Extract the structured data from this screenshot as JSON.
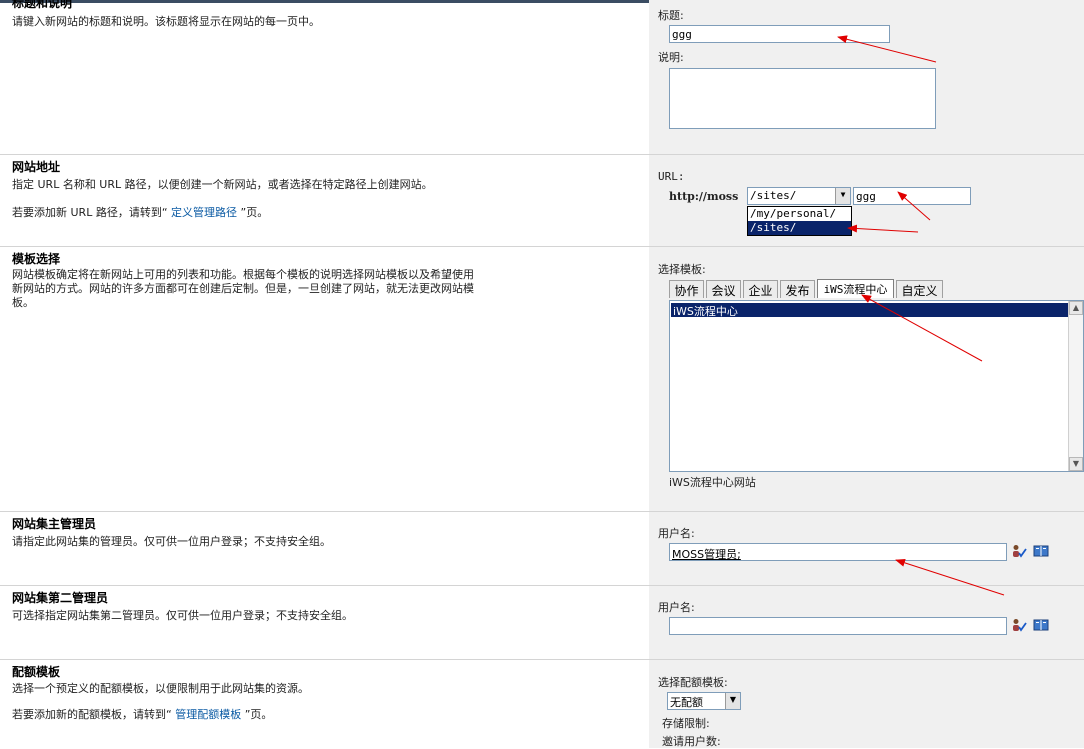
{
  "sections": {
    "title_desc": {
      "title": "标题和说明",
      "desc": "请键入新网站的标题和说明。该标题将显示在网站的每一页中。",
      "title_label": "标题:",
      "title_value": "ggg",
      "desc_label": "说明:",
      "desc_value": ""
    },
    "site_address": {
      "title": "网站地址",
      "desc": "指定 URL 名称和 URL 路径，以便创建一个新网站，或者选择在特定路径上创建网站。",
      "hint_prefix": "若要添加新 URL 路径，请转到“",
      "hint_link": "定义管理路径",
      "hint_suffix": "”页。",
      "url_label": "URL:",
      "url_prefix": "http://moss",
      "path_selected": "/sites/",
      "path_options": [
        "/my/personal/",
        "/sites/"
      ],
      "site_name": "ggg"
    },
    "template": {
      "title": "模板选择",
      "desc": "网站模板确定将在新网站上可用的列表和功能。根据每个模板的说明选择网站模板以及希望使用新网站的方式。网站的许多方面都可在创建后定制。但是，一旦创建了网站，就无法更改网站模板。",
      "select_label": "选择模板:",
      "tabs": [
        "协作",
        "会议",
        "企业",
        "发布",
        "iWS流程中心",
        "自定义"
      ],
      "list_item": "iWS流程中心",
      "item_desc": "iWS流程中心网站"
    },
    "primary_admin": {
      "title": "网站集主管理员",
      "desc": "请指定此网站集的管理员。仅可供一位用户登录；不支持安全组。",
      "user_label": "用户名:",
      "user_value": "MOSS管理员;"
    },
    "secondary_admin": {
      "title": "网站集第二管理员",
      "desc": "可选择指定网站集第二管理员。仅可供一位用户登录；不支持安全组。",
      "user_label": "用户名:",
      "user_value": ""
    },
    "quota": {
      "title": "配额模板",
      "desc": "选择一个预定义的配额模板，以便限制用于此网站集的资源。",
      "hint_prefix": "若要添加新的配额模板，请转到“",
      "hint_link": "管理配额模板",
      "hint_suffix": "”页。",
      "select_label": "选择配额模板:",
      "selected": "无配额",
      "storage_label": "存储限制:",
      "invite_label": "邀请用户数:"
    }
  },
  "colors": {
    "link": "#0a5aa3",
    "selection": "#0a246a",
    "annotation_arrow": "#e00000"
  }
}
